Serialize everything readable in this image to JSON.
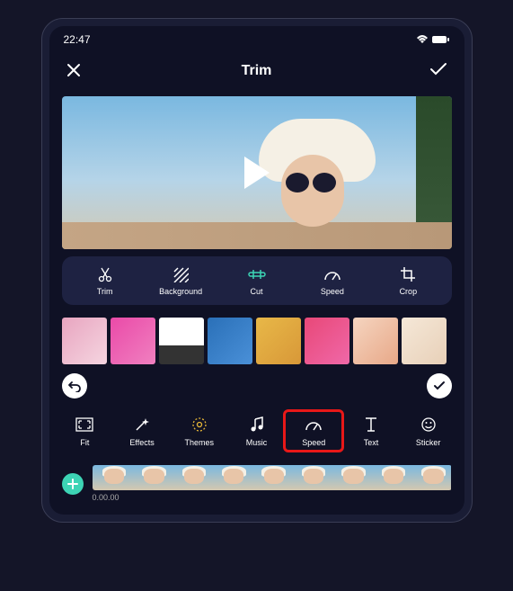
{
  "status": {
    "time": "22:47"
  },
  "header": {
    "title": "Trim"
  },
  "toolbar": {
    "items": [
      {
        "label": "Trim"
      },
      {
        "label": "Background"
      },
      {
        "label": "Cut"
      },
      {
        "label": "Speed"
      },
      {
        "label": "Crop"
      }
    ]
  },
  "bottom": {
    "items": [
      {
        "label": "Fit"
      },
      {
        "label": "Effects"
      },
      {
        "label": "Themes"
      },
      {
        "label": "Music"
      },
      {
        "label": "Speed"
      },
      {
        "label": "Text"
      },
      {
        "label": "Sticker"
      }
    ]
  },
  "timeline": {
    "timecode": "0.00.00"
  }
}
